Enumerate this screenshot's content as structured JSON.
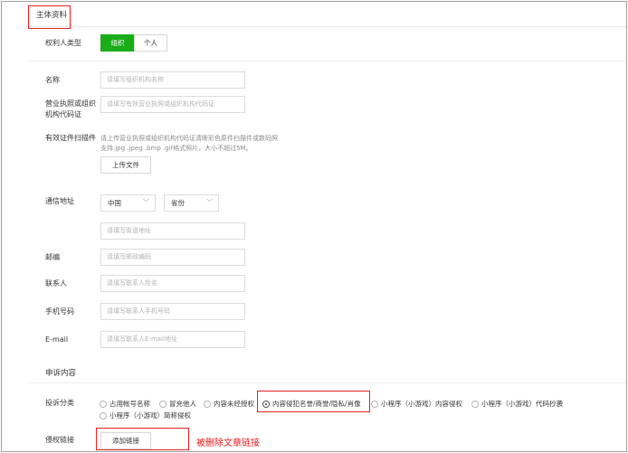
{
  "colors": {
    "accent": "#1aad19",
    "annotation": "#e32020"
  },
  "section_header": {
    "title": "主体资料"
  },
  "rights_holder_type": {
    "label": "权利人类型",
    "options": [
      "组织",
      "个人"
    ],
    "selected": "组织"
  },
  "fields": {
    "name": {
      "label": "名称",
      "placeholder": "请填写组织机构名称"
    },
    "license": {
      "label_line1": "营业执照或组织",
      "label_line2": "机构代码证",
      "placeholder": "请填写有效营业执照或组织机构代码证"
    },
    "scan": {
      "label": "有效证件扫描件",
      "hint_line1": "请上传营业执照或组织机构代码证清晰彩色原件扫描件或数码照",
      "hint_line2": "支持.jpg .jpeg .bmp .gif格式照片，大小不超过5M。",
      "upload_button": "上传文件"
    },
    "address": {
      "label": "通信地址",
      "country": "中国",
      "province": "省份",
      "street_placeholder": "请填写街道地址",
      "chevron_icon": "chevron-down-icon"
    },
    "postcode": {
      "label": "邮编",
      "placeholder": "请填写邮政编码"
    },
    "contact": {
      "label": "联系人",
      "placeholder": "请填写联系人姓名"
    },
    "phone": {
      "label": "手机号码",
      "placeholder": "请填写联系人手机号码"
    },
    "email": {
      "label": "E-mail",
      "placeholder": "请填写联系人E-mail地址"
    }
  },
  "complaint_section": {
    "title": "申诉内容"
  },
  "complaint_category": {
    "label": "投诉分类",
    "options": [
      "占用帐号名称",
      "冒充他人",
      "内容未经授权",
      "内容侵犯名誉/商誉/隐私/肖像",
      "小程序（小游戏）内容侵权",
      "小程序（小游戏）代码抄袭",
      "小程序（小游戏）简称侵权"
    ],
    "selected": "内容侵犯名誉/商誉/隐私/肖像"
  },
  "infringing_link": {
    "label": "侵权链接",
    "add_button": "添加链接"
  },
  "annotation": {
    "text": "被删除文章链接"
  }
}
